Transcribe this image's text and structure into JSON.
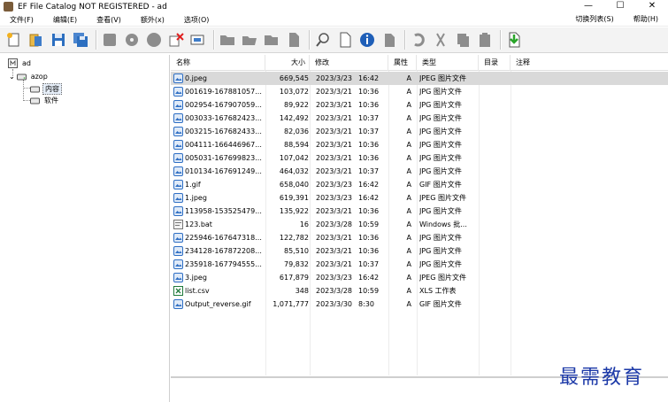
{
  "window": {
    "title": "EF File Catalog NOT REGISTERED - ad",
    "controls": [
      "—",
      "☐",
      "✕"
    ]
  },
  "menu": {
    "items": [
      "文件(F)",
      "编辑(E)",
      "查看(V)",
      "额外(x)",
      "选项(O)"
    ],
    "right_items": [
      "切换列表(S)",
      "帮助(H)"
    ]
  },
  "tree": {
    "root": "ad",
    "child": "azop",
    "grandchildren": [
      "内容",
      "软件"
    ]
  },
  "columns": [
    "名称",
    "大小",
    "修改",
    "属性",
    "类型",
    "目录",
    "注释"
  ],
  "files": [
    {
      "name": "0.jpeg",
      "size": "669,545",
      "date": "2023/3/23",
      "time": "16:42",
      "attr": "A",
      "type": "JPEG 图片文件",
      "icon": "image-icon"
    },
    {
      "name": "001619-167881057...",
      "size": "103,072",
      "date": "2023/3/21",
      "time": "10:36",
      "attr": "A",
      "type": "JPG 图片文件",
      "icon": "image-icon"
    },
    {
      "name": "002954-167907059...",
      "size": "89,922",
      "date": "2023/3/21",
      "time": "10:36",
      "attr": "A",
      "type": "JPG 图片文件",
      "icon": "image-icon"
    },
    {
      "name": "003033-167682423...",
      "size": "142,492",
      "date": "2023/3/21",
      "time": "10:37",
      "attr": "A",
      "type": "JPG 图片文件",
      "icon": "image-icon"
    },
    {
      "name": "003215-167682433...",
      "size": "82,036",
      "date": "2023/3/21",
      "time": "10:37",
      "attr": "A",
      "type": "JPG 图片文件",
      "icon": "image-icon"
    },
    {
      "name": "004111-166446967...",
      "size": "88,594",
      "date": "2023/3/21",
      "time": "10:36",
      "attr": "A",
      "type": "JPG 图片文件",
      "icon": "image-icon"
    },
    {
      "name": "005031-167699823...",
      "size": "107,042",
      "date": "2023/3/21",
      "time": "10:36",
      "attr": "A",
      "type": "JPG 图片文件",
      "icon": "image-icon"
    },
    {
      "name": "010134-167691249...",
      "size": "464,032",
      "date": "2023/3/21",
      "time": "10:37",
      "attr": "A",
      "type": "JPG 图片文件",
      "icon": "image-icon"
    },
    {
      "name": "1.gif",
      "size": "658,040",
      "date": "2023/3/23",
      "time": "16:42",
      "attr": "A",
      "type": "GIF 图片文件",
      "icon": "image-icon"
    },
    {
      "name": "1.jpeg",
      "size": "619,391",
      "date": "2023/3/23",
      "time": "16:42",
      "attr": "A",
      "type": "JPEG 图片文件",
      "icon": "image-icon"
    },
    {
      "name": "113958-153525479...",
      "size": "135,922",
      "date": "2023/3/21",
      "time": "10:36",
      "attr": "A",
      "type": "JPG 图片文件",
      "icon": "image-icon"
    },
    {
      "name": "123.bat",
      "size": "16",
      "date": "2023/3/28",
      "time": "10:59",
      "attr": "A",
      "type": "Windows 批...",
      "icon": "batch-icon"
    },
    {
      "name": "225946-167647318...",
      "size": "122,782",
      "date": "2023/3/21",
      "time": "10:36",
      "attr": "A",
      "type": "JPG 图片文件",
      "icon": "image-icon"
    },
    {
      "name": "234128-167872208...",
      "size": "85,510",
      "date": "2023/3/21",
      "time": "10:36",
      "attr": "A",
      "type": "JPG 图片文件",
      "icon": "image-icon"
    },
    {
      "name": "235918-167794555...",
      "size": "79,832",
      "date": "2023/3/21",
      "time": "10:37",
      "attr": "A",
      "type": "JPG 图片文件",
      "icon": "image-icon"
    },
    {
      "name": "3.jpeg",
      "size": "617,879",
      "date": "2023/3/23",
      "time": "16:42",
      "attr": "A",
      "type": "JPEG 图片文件",
      "icon": "image-icon"
    },
    {
      "name": "list.csv",
      "size": "348",
      "date": "2023/3/28",
      "time": "10:59",
      "attr": "A",
      "type": "XLS 工作表",
      "icon": "spreadsheet-icon"
    },
    {
      "name": "Output_reverse.gif",
      "size": "1,071,777",
      "date": "2023/3/30",
      "time": "8:30",
      "attr": "A",
      "type": "GIF 图片文件",
      "icon": "image-icon"
    }
  ],
  "watermark": "最需教育",
  "colors": {
    "selection": "#d9d9d9",
    "image_icon": "#2f6fc4",
    "watermark": "#1d3aa8"
  }
}
